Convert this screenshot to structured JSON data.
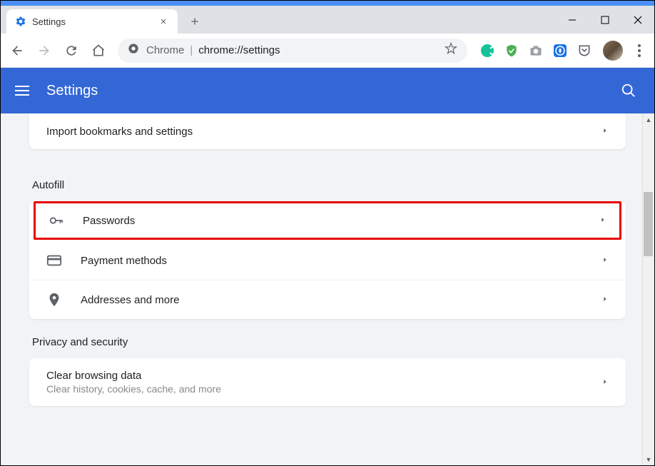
{
  "window": {
    "tab_title": "Settings"
  },
  "omnibox": {
    "security_label": "Chrome",
    "url": "chrome://settings"
  },
  "header": {
    "title": "Settings"
  },
  "sections": {
    "import_row": "Import bookmarks and settings",
    "autofill": {
      "title": "Autofill",
      "passwords": "Passwords",
      "payment": "Payment methods",
      "addresses": "Addresses and more"
    },
    "privacy": {
      "title": "Privacy and security",
      "clear_title": "Clear browsing data",
      "clear_sub": "Clear history, cookies, cache, and more"
    }
  }
}
